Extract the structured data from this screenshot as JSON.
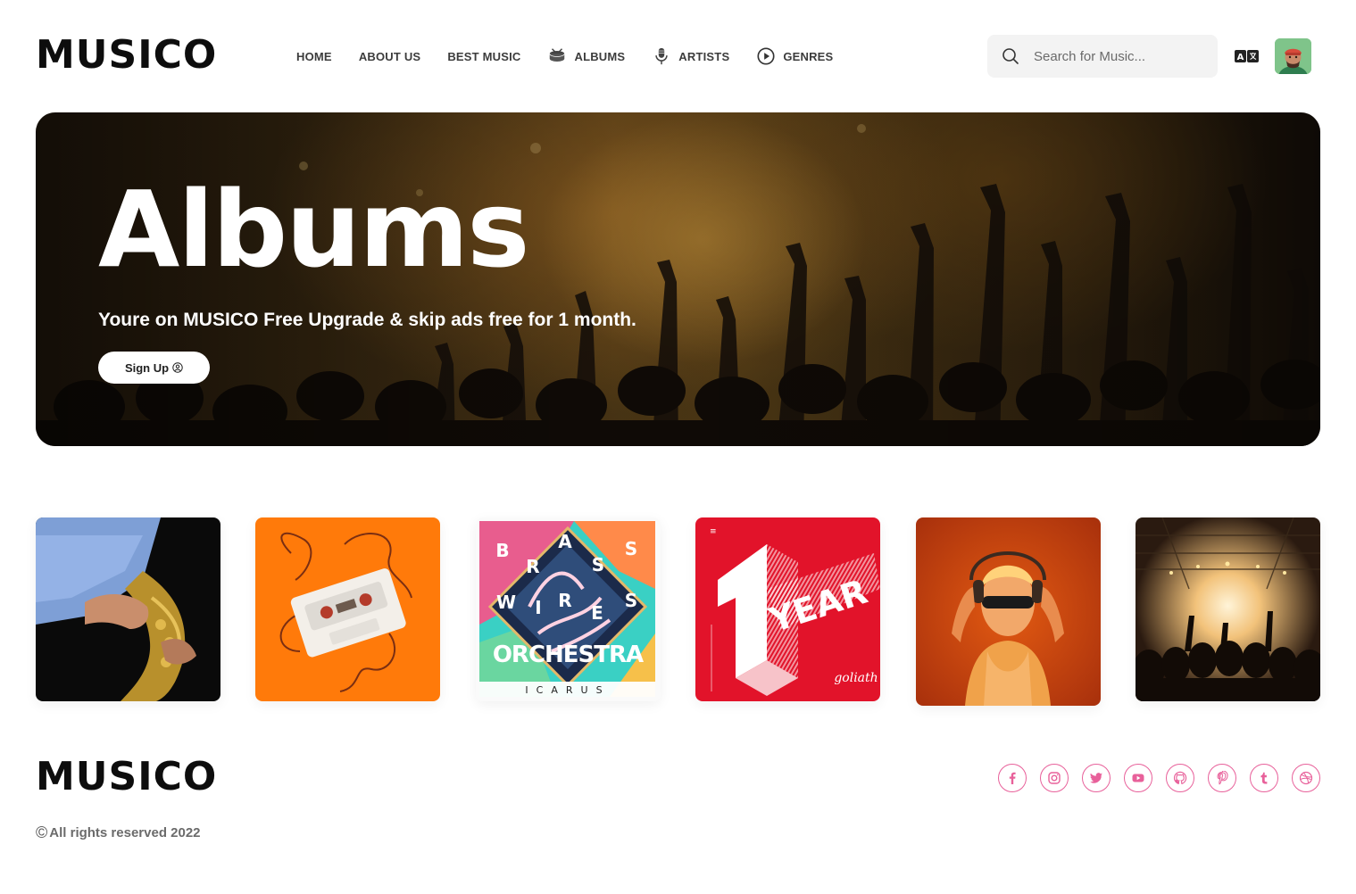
{
  "brand": {
    "logo_text": "MUSICO"
  },
  "nav": {
    "items": [
      {
        "label": "HOME",
        "icon": null
      },
      {
        "label": "ABOUT US",
        "icon": null
      },
      {
        "label": "BEST MUSIC",
        "icon": null
      },
      {
        "label": "ALBUMS",
        "icon": "drum-icon"
      },
      {
        "label": "ARTISTS",
        "icon": "microphone-icon"
      },
      {
        "label": "GENRES",
        "icon": "play-circle-icon"
      }
    ]
  },
  "search": {
    "placeholder": "Search for Music..."
  },
  "hero": {
    "title": "Albums",
    "subtitle": "Youre on MUSICO Free Upgrade & skip ads free for 1 month.",
    "button_label": "Sign Up"
  },
  "albums": [
    {
      "art": "saxophone-player"
    },
    {
      "art": "cassette-tape-on-orange"
    },
    {
      "art": "brass-wires-orchestra-cover",
      "text": [
        "B",
        "R",
        "A",
        "S",
        "S",
        "W",
        "I",
        "R",
        "E",
        "S",
        "ORCHESTRA",
        "ICARUS"
      ]
    },
    {
      "art": "one-year-cover",
      "text": "YEAR"
    },
    {
      "art": "girl-with-headphones"
    },
    {
      "art": "concert-stage-crowd"
    }
  ],
  "footer": {
    "logo_text": "MUSICO",
    "copyright_symbol": "©",
    "copyright": "All rights reserved 2022",
    "socials": [
      "facebook-icon",
      "instagram-icon",
      "twitter-icon",
      "youtube-icon",
      "github-icon",
      "pinterest-icon",
      "tumblr-icon",
      "dribbble-icon"
    ]
  },
  "colors": {
    "accent": "#e8609a",
    "hero_text": "#ffffff",
    "nav_text": "#3c3c3c",
    "footer_text": "#6b6b6b"
  }
}
